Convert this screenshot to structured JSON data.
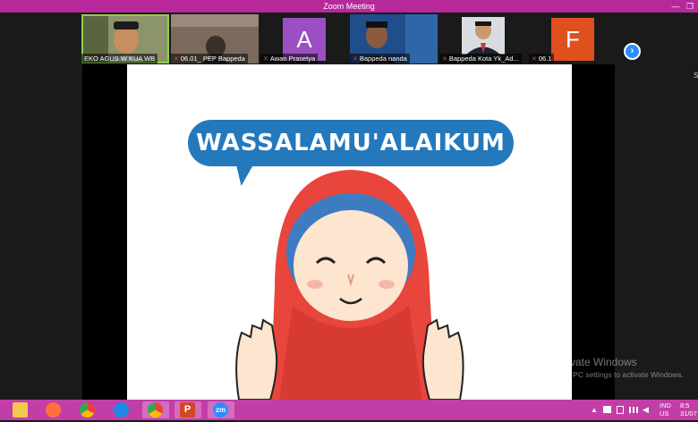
{
  "window": {
    "title": "Zoom Meeting",
    "min_glyph": "—",
    "restore_glyph": "❐"
  },
  "participants": [
    {
      "name": "EKO AGUS W KUA WB",
      "type": "video",
      "muted": false
    },
    {
      "name": "06.01_ PEP Bappeda",
      "type": "video",
      "muted": true
    },
    {
      "name": "Awan Prasetya",
      "type": "letter",
      "letter": "A",
      "color": "#9b4fc2",
      "muted": true
    },
    {
      "name": "Bappeda nanda",
      "type": "video",
      "muted": true
    },
    {
      "name": "Bappeda Kota Yk_Ad...",
      "type": "video",
      "muted": true
    },
    {
      "name": "06.1",
      "type": "letter",
      "letter": "F",
      "color": "#e0501f",
      "muted": true
    }
  ],
  "strip": {
    "next_glyph": "›",
    "edge_letter": "S"
  },
  "slide": {
    "greeting": "WASSALAMU'ALAIKUM",
    "bubble_color": "#2479bd",
    "hijab_color": "#e8453c",
    "skin_color": "#fde5cf"
  },
  "watermark": {
    "title": "Activate Windows",
    "subtitle": "Go to PC settings to activate Windows."
  },
  "taskbar": {
    "color": "#c23ea7",
    "apps": [
      {
        "name": "file-explorer",
        "color": "#f2c94c"
      },
      {
        "name": "firefox",
        "color": "#ff7139"
      },
      {
        "name": "chrome",
        "color": "#34a853"
      },
      {
        "name": "edge",
        "color": "#1e88e5"
      },
      {
        "name": "chrome-profile",
        "color": "#ea4335"
      },
      {
        "name": "powerpoint",
        "color": "#d24726"
      },
      {
        "name": "zoom",
        "color": "#2d8cff"
      }
    ],
    "zoom_label": "zm",
    "ppt_label": "P",
    "tray": {
      "lang_top": "IND",
      "lang_bottom": "US",
      "time": "8:5",
      "date": "31/07"
    }
  }
}
